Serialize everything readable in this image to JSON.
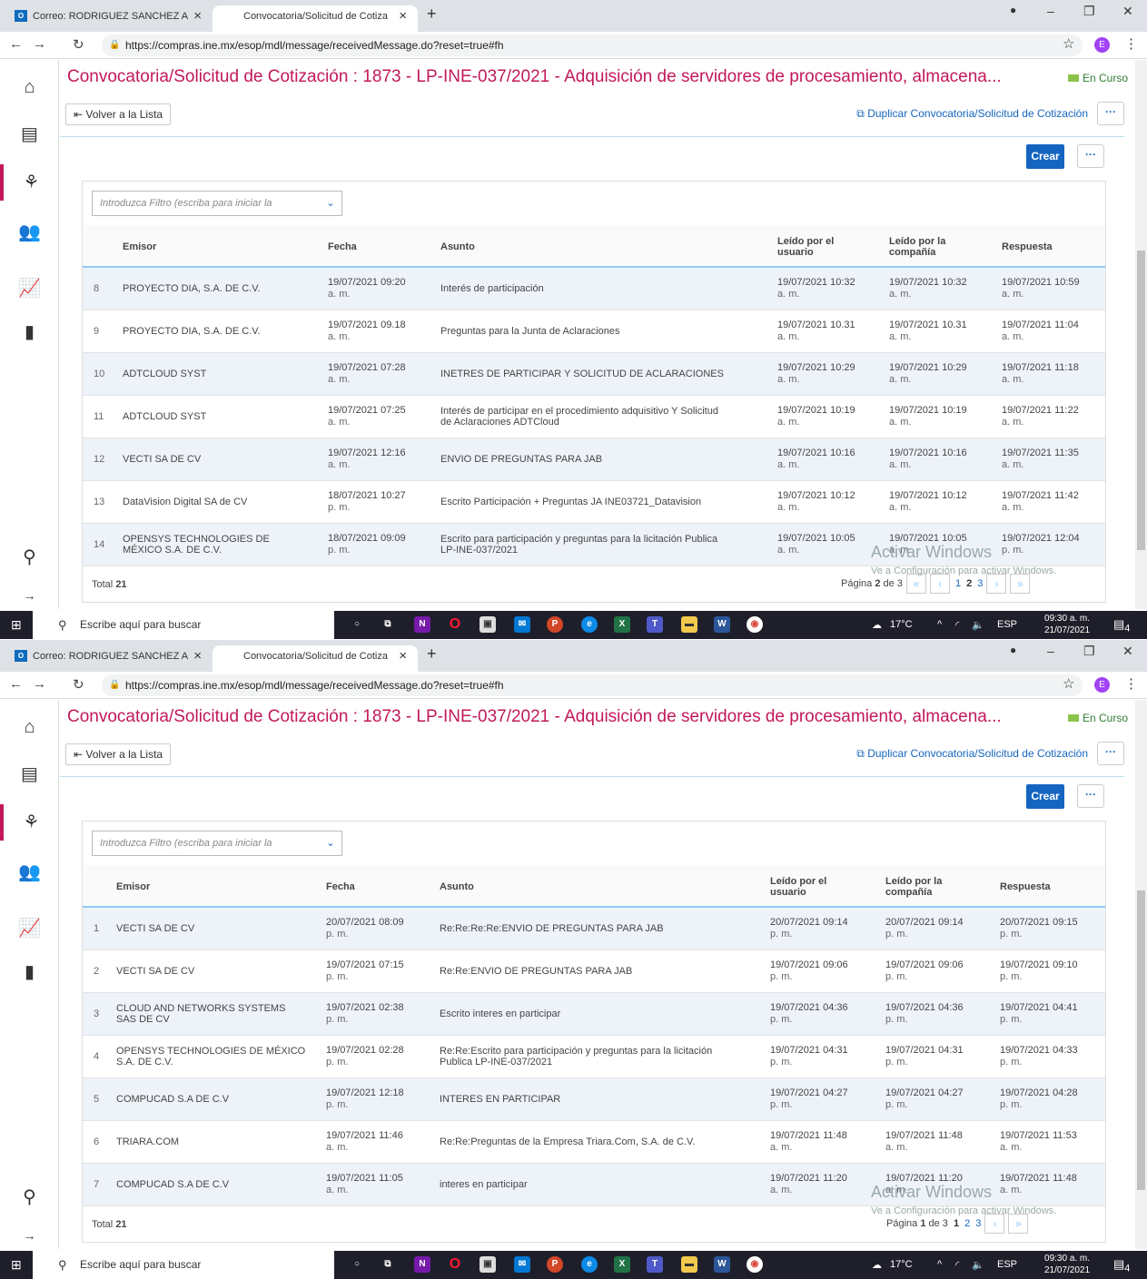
{
  "browser": {
    "tab1_title": "Correo: RODRIGUEZ SANCHEZ A",
    "tab2_title": "Convocatoria/Solicitud de Cotiza",
    "url": "https://compras.ine.mx/esop/mdl/message/receivedMessage.do?reset=true#fh",
    "profile_initial": "E"
  },
  "header": {
    "title": "Convocatoria/Solicitud de Cotización : 1873 - LP-INE-037/2021 - Adquisición de servidores de procesamiento, almacena...",
    "status": "En Curso",
    "back_label": "Volver a la Lista",
    "duplicate_label": "Duplicar Convocatoria/Solicitud de Cotización",
    "more": "···",
    "create_label": "Crear"
  },
  "filter_placeholder": "Introduzca Filtro (escriba para iniciar la",
  "columns": {
    "emisor": "Emisor",
    "fecha": "Fecha",
    "asunto": "Asunto",
    "leido_usuario_1": "Leído por el",
    "leido_usuario_2": "usuario",
    "leido_compania_1": "Leído por la",
    "leido_compania_2": "compañía",
    "respuesta": "Respuesta"
  },
  "screens": [
    {
      "total_label": "Total",
      "total": "21",
      "page_label": "Página",
      "page": "2",
      "of_label": "de 3",
      "pages": [
        "1",
        "2",
        "3"
      ],
      "rows": [
        {
          "n": "8",
          "emisor": [
            "PROYECTO DIA, S.A. DE C.V."
          ],
          "fecha": [
            "19/07/2021 09:20",
            "a. m."
          ],
          "asunto": [
            "Interés de participación"
          ],
          "lu": [
            "19/07/2021 10:32",
            "a. m."
          ],
          "lc": [
            "19/07/2021 10:32",
            "a. m."
          ],
          "resp": [
            "19/07/2021 10:59",
            "a. m."
          ]
        },
        {
          "n": "9",
          "emisor": [
            "PROYECTO DIA, S.A. DE C.V."
          ],
          "fecha": [
            "19/07/2021 09.18",
            "a. m."
          ],
          "asunto": [
            "Preguntas para la Junta de Aclaraciones"
          ],
          "lu": [
            "19/07/2021 10.31",
            "a. m."
          ],
          "lc": [
            "19/07/2021 10.31",
            "a. m."
          ],
          "resp": [
            "19/07/2021 11:04",
            "a. m."
          ]
        },
        {
          "n": "10",
          "emisor": [
            "ADTCLOUD SYST"
          ],
          "fecha": [
            "19/07/2021 07:28",
            "a. m."
          ],
          "asunto": [
            "INETRES DE PARTICIPAR Y SOLICITUD DE ACLARACIONES"
          ],
          "lu": [
            "19/07/2021 10:29",
            "a. m."
          ],
          "lc": [
            "19/07/2021 10:29",
            "a. m."
          ],
          "resp": [
            "19/07/2021 11:18",
            "a. m."
          ]
        },
        {
          "n": "11",
          "emisor": [
            "ADTCLOUD SYST"
          ],
          "fecha": [
            "19/07/2021 07:25",
            "a. m."
          ],
          "asunto": [
            "Interés de participar en el procedimiento adquisitivo Y Solicitud",
            "de Aclaraciones ADTCloud"
          ],
          "lu": [
            "19/07/2021 10:19",
            "a. m."
          ],
          "lc": [
            "19/07/2021 10:19",
            "a. m."
          ],
          "resp": [
            "19/07/2021 11:22",
            "a. m."
          ]
        },
        {
          "n": "12",
          "emisor": [
            "VECTI SA DE CV"
          ],
          "fecha": [
            "19/07/2021 12:16",
            "a. m."
          ],
          "asunto": [
            "ENVIO DE PREGUNTAS PARA JAB"
          ],
          "lu": [
            "19/07/2021 10:16",
            "a. m."
          ],
          "lc": [
            "19/07/2021 10:16",
            "a. m."
          ],
          "resp": [
            "19/07/2021 11:35",
            "a. m."
          ]
        },
        {
          "n": "13",
          "emisor": [
            "DataVision Digital SA de CV"
          ],
          "fecha": [
            "18/07/2021 10:27",
            "p. m."
          ],
          "asunto": [
            "Escrito Participación + Preguntas JA INE03721_Datavision"
          ],
          "lu": [
            "19/07/2021 10:12",
            "a. m."
          ],
          "lc": [
            "19/07/2021 10:12",
            "a. m."
          ],
          "resp": [
            "19/07/2021 11:42",
            "a. m."
          ]
        },
        {
          "n": "14",
          "emisor": [
            "OPENSYS TECHNOLOGIES DE",
            "MÉXICO S.A. DE C.V."
          ],
          "fecha": [
            "18/07/2021 09:09",
            "p. m."
          ],
          "asunto": [
            "Escrito para participación y preguntas para la licitación Publica",
            "LP-INE-037/2021"
          ],
          "lu": [
            "19/07/2021 10:05",
            "a. m."
          ],
          "lc": [
            "19/07/2021 10:05",
            "a. m."
          ],
          "resp": [
            "19/07/2021 12:04",
            "p. m."
          ]
        }
      ]
    },
    {
      "total_label": "Total",
      "total": "21",
      "page_label": "Página",
      "page": "1",
      "of_label": "de 3",
      "pages": [
        "1",
        "2",
        "3"
      ],
      "rows": [
        {
          "n": "1",
          "emisor": [
            "VECTI SA DE CV"
          ],
          "fecha": [
            "20/07/2021 08:09",
            "p. m."
          ],
          "asunto": [
            "Re:Re:Re:Re:ENVIO DE PREGUNTAS PARA JAB"
          ],
          "lu": [
            "20/07/2021 09:14",
            "p. m."
          ],
          "lc": [
            "20/07/2021 09:14",
            "p. m."
          ],
          "resp": [
            "20/07/2021 09:15",
            "p. m."
          ]
        },
        {
          "n": "2",
          "emisor": [
            "VECTI SA DE CV"
          ],
          "fecha": [
            "19/07/2021 07:15",
            "p. m."
          ],
          "asunto": [
            "Re:Re:ENVIO DE PREGUNTAS PARA JAB"
          ],
          "lu": [
            "19/07/2021 09:06",
            "p. m."
          ],
          "lc": [
            "19/07/2021 09:06",
            "p. m."
          ],
          "resp": [
            "19/07/2021 09:10",
            "p. m."
          ]
        },
        {
          "n": "3",
          "emisor": [
            "CLOUD AND NETWORKS SYSTEMS",
            "SAS DE CV"
          ],
          "fecha": [
            "19/07/2021 02:38",
            "p. m."
          ],
          "asunto": [
            "Escrito interes en participar"
          ],
          "lu": [
            "19/07/2021 04:36",
            "p. m."
          ],
          "lc": [
            "19/07/2021 04:36",
            "p. m."
          ],
          "resp": [
            "19/07/2021 04:41",
            "p. m."
          ]
        },
        {
          "n": "4",
          "emisor": [
            "OPENSYS TECHNOLOGIES DE MÉXICO",
            "S.A. DE C.V."
          ],
          "fecha": [
            "19/07/2021 02:28",
            "p. m."
          ],
          "asunto": [
            "Re:Re:Escrito para participación y preguntas para la licitación",
            "Publica LP-INE-037/2021"
          ],
          "lu": [
            "19/07/2021 04:31",
            "p. m."
          ],
          "lc": [
            "19/07/2021 04:31",
            "p. m."
          ],
          "resp": [
            "19/07/2021 04:33",
            "p. m."
          ]
        },
        {
          "n": "5",
          "emisor": [
            "COMPUCAD S.A DE C.V"
          ],
          "fecha": [
            "19/07/2021 12:18",
            "p. m."
          ],
          "asunto": [
            "INTERES EN PARTICIPAR"
          ],
          "lu": [
            "19/07/2021 04:27",
            "p. m."
          ],
          "lc": [
            "19/07/2021 04:27",
            "p. m."
          ],
          "resp": [
            "19/07/2021 04:28",
            "p. m."
          ]
        },
        {
          "n": "6",
          "emisor": [
            "TRIARA.COM"
          ],
          "fecha": [
            "19/07/2021 11:46",
            "a. m."
          ],
          "asunto": [
            "Re:Re:Preguntas de la Empresa Triara.Com, S.A. de C.V."
          ],
          "lu": [
            "19/07/2021 11:48",
            "a. m."
          ],
          "lc": [
            "19/07/2021 11:48",
            "a. m."
          ],
          "resp": [
            "19/07/2021 11:53",
            "a. m."
          ]
        },
        {
          "n": "7",
          "emisor": [
            "COMPUCAD S.A DE C.V"
          ],
          "fecha": [
            "19/07/2021 11:05",
            "a. m."
          ],
          "asunto": [
            "interes en participar"
          ],
          "lu": [
            "19/07/2021 11:20",
            "a. m."
          ],
          "lc": [
            "19/07/2021 11:20",
            "a. m."
          ],
          "resp": [
            "19/07/2021 11:48",
            "a. m."
          ]
        }
      ]
    }
  ],
  "watermark": {
    "line1": "Activar Windows",
    "line2": "Ve a Configuración para activar Windows."
  },
  "taskbar": {
    "search_placeholder": "Escribe aquí para buscar",
    "temperature": "17°C",
    "language": "ESP",
    "time": "09:30 a. m.",
    "date": "21/07/2021",
    "notifications": "4"
  },
  "icons": [
    "home-icon",
    "dashboard-icon",
    "handshake-icon",
    "users-icon",
    "chart-icon",
    "documents-icon",
    "search-icon",
    "arrow-right-icon"
  ]
}
